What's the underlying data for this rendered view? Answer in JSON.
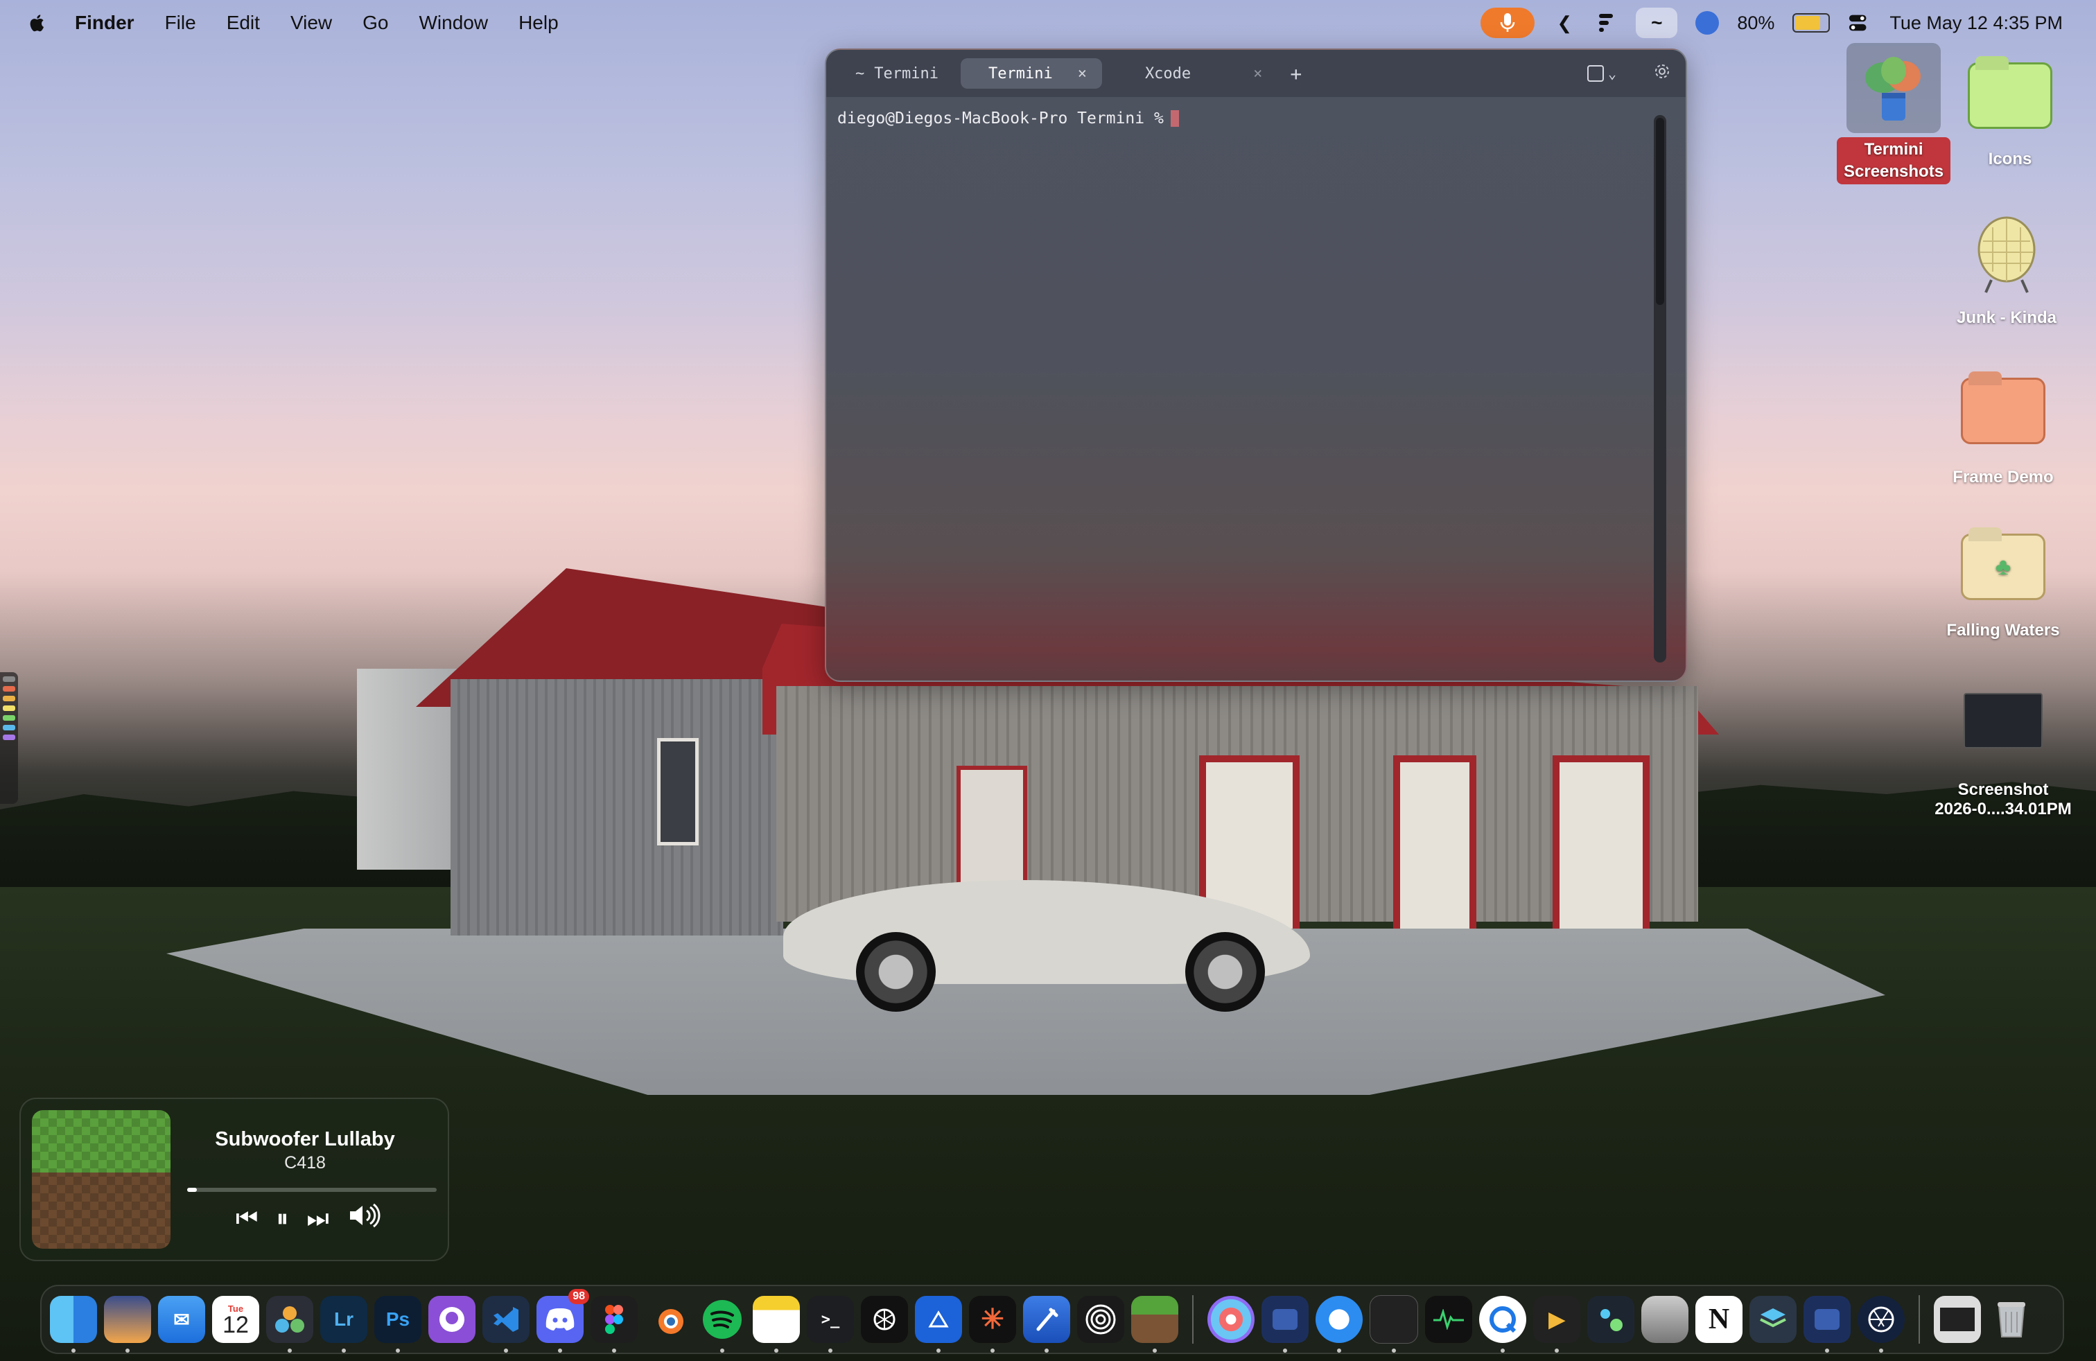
{
  "menubar": {
    "app_name": "Finder",
    "items": [
      "File",
      "Edit",
      "View",
      "Go",
      "Window",
      "Help"
    ],
    "battery_percent": "80%",
    "battery_level": 0.8,
    "datetime": "Tue May 12  4:35 PM"
  },
  "terminal": {
    "tabs": [
      {
        "label": "Termini",
        "icon": "tilde-icon"
      },
      {
        "label": "Termini"
      },
      {
        "label": "Xcode"
      }
    ],
    "tilde": "~",
    "close_glyph": "×",
    "plus_glyph": "+",
    "prompt": "diego@Diegos-MacBook-Pro Termini %"
  },
  "desktop_icons": [
    {
      "label_line1": "Termini",
      "label_line2": "Screenshots",
      "selected": true
    },
    {
      "label": "Icons"
    },
    {
      "label": "Junk - Kinda"
    },
    {
      "label": "Frame Demo"
    },
    {
      "label": "Falling Waters"
    },
    {
      "label_line1": "Screenshot",
      "label_line2": "2026-0....34.01PM"
    }
  ],
  "music": {
    "title": "Subwoofer Lullaby",
    "artist": "C418",
    "progress": 0.04
  },
  "dock": {
    "calendar_day": "Tue",
    "calendar_date": "12",
    "lightroom": "Lr",
    "photoshop": "Ps",
    "discord_badge": "98",
    "notion": "N",
    "terminal_glyph": ">_"
  },
  "colors": {
    "mic_pill": "#f07a2c",
    "terminal_bg": "#4e5361",
    "selected_label": "#c0363c"
  }
}
